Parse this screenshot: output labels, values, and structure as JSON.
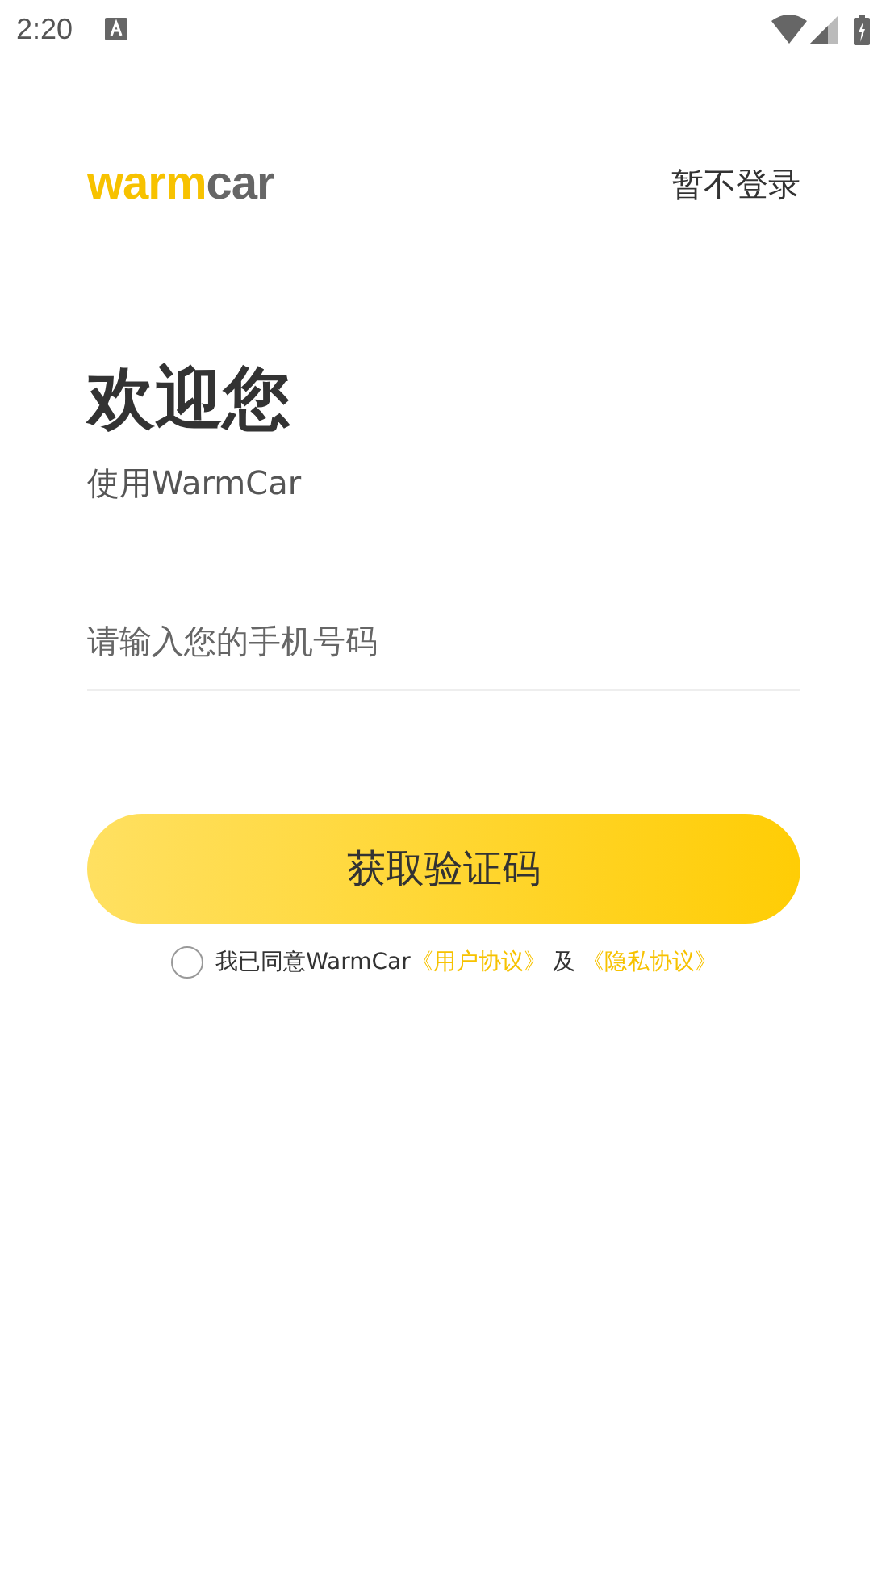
{
  "status_bar": {
    "time": "2:20"
  },
  "header": {
    "logo": [
      {
        "text": "warm",
        "color": "#f7c200"
      },
      {
        "text": "car",
        "color": "#666666"
      }
    ],
    "skip_link": "暂不登录"
  },
  "title": "欢迎您",
  "subtitle": "使用WarmCar",
  "phone_field": {
    "placeholder": "请输入您的手机号码"
  },
  "submit_button": "获取验证码",
  "agreement": {
    "checked": false,
    "parts": [
      {
        "kind": "text",
        "text": "我已同意WarmCar"
      },
      {
        "kind": "link",
        "text": "《用户协议》"
      },
      {
        "kind": "text",
        "text": "及"
      },
      {
        "kind": "link",
        "text": "《隐私协议》"
      }
    ]
  }
}
